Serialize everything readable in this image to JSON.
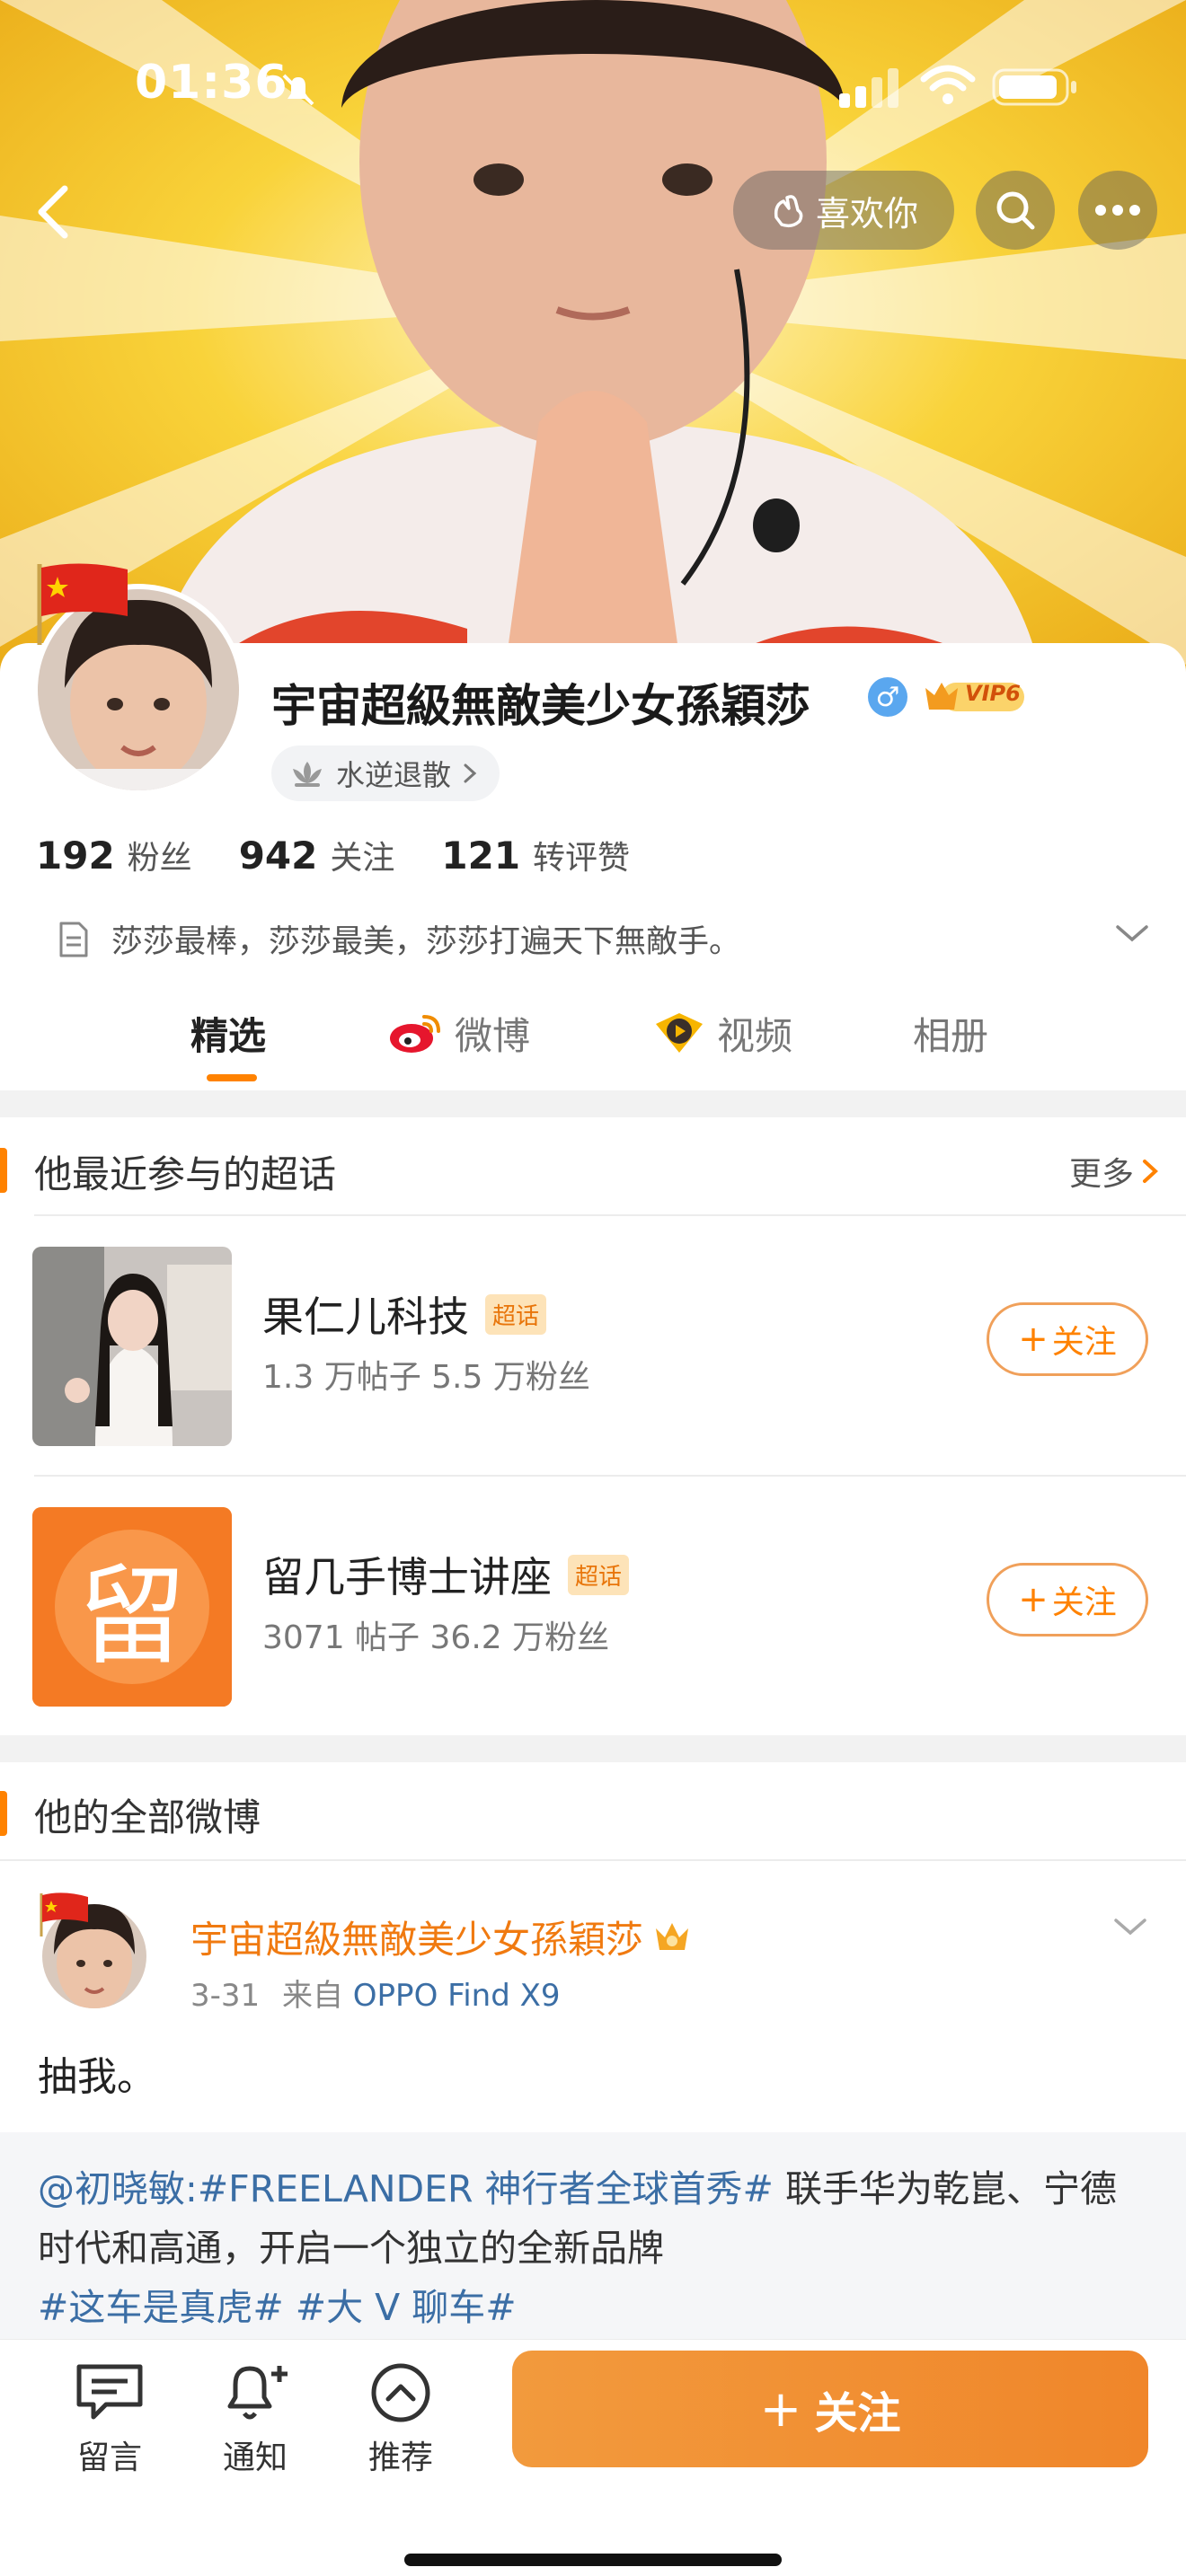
{
  "status_bar": {
    "time": "01:36"
  },
  "header": {
    "like_label": "喜欢你"
  },
  "profile": {
    "name": "宇宙超級無敵美少女孫穎莎",
    "vip": "VIP6",
    "title_pill": "水逆退散",
    "stats": [
      {
        "value": "192",
        "label": "粉丝"
      },
      {
        "value": "942",
        "label": "关注"
      },
      {
        "value": "121",
        "label": "转评赞"
      }
    ],
    "bio": "莎莎最棒，莎莎最美，莎莎打遍天下無敵手。"
  },
  "tabs": [
    {
      "label": "精选"
    },
    {
      "label": "微博"
    },
    {
      "label": "视频"
    },
    {
      "label": "相册"
    }
  ],
  "supertopics": {
    "heading": "他最近参与的超话",
    "more": "更多",
    "badge": "超话",
    "follow_label": "关注",
    "thumb_char": "留",
    "items": [
      {
        "name": "果仁儿科技",
        "meta": "1.3 万帖子  5.5 万粉丝"
      },
      {
        "name": "留几手博士讲座",
        "meta": "3071 帖子  36.2 万粉丝"
      }
    ]
  },
  "weibo": {
    "heading": "他的全部微博",
    "post": {
      "author": "宇宙超級無敵美少女孫穎莎",
      "date": "3-31",
      "from": "来自",
      "device": "OPPO Find X9",
      "text": "抽我。",
      "repost_mention": "@初晓敏:#FREELANDER 神行者全球首秀#",
      "repost_body": " 联手华为乾崑、宁德时代和高通，开启一个独立的全新品牌",
      "repost_tags": "#这车是真虎# #大 V 聊车#"
    }
  },
  "bottom_bar": {
    "comment": "留言",
    "notify": "通知",
    "recommend": "推荐",
    "follow": "关注"
  },
  "colors": {
    "accent": "#ff8200",
    "link": "#3b6ea5",
    "cover_yellow": "#f7c21a"
  }
}
